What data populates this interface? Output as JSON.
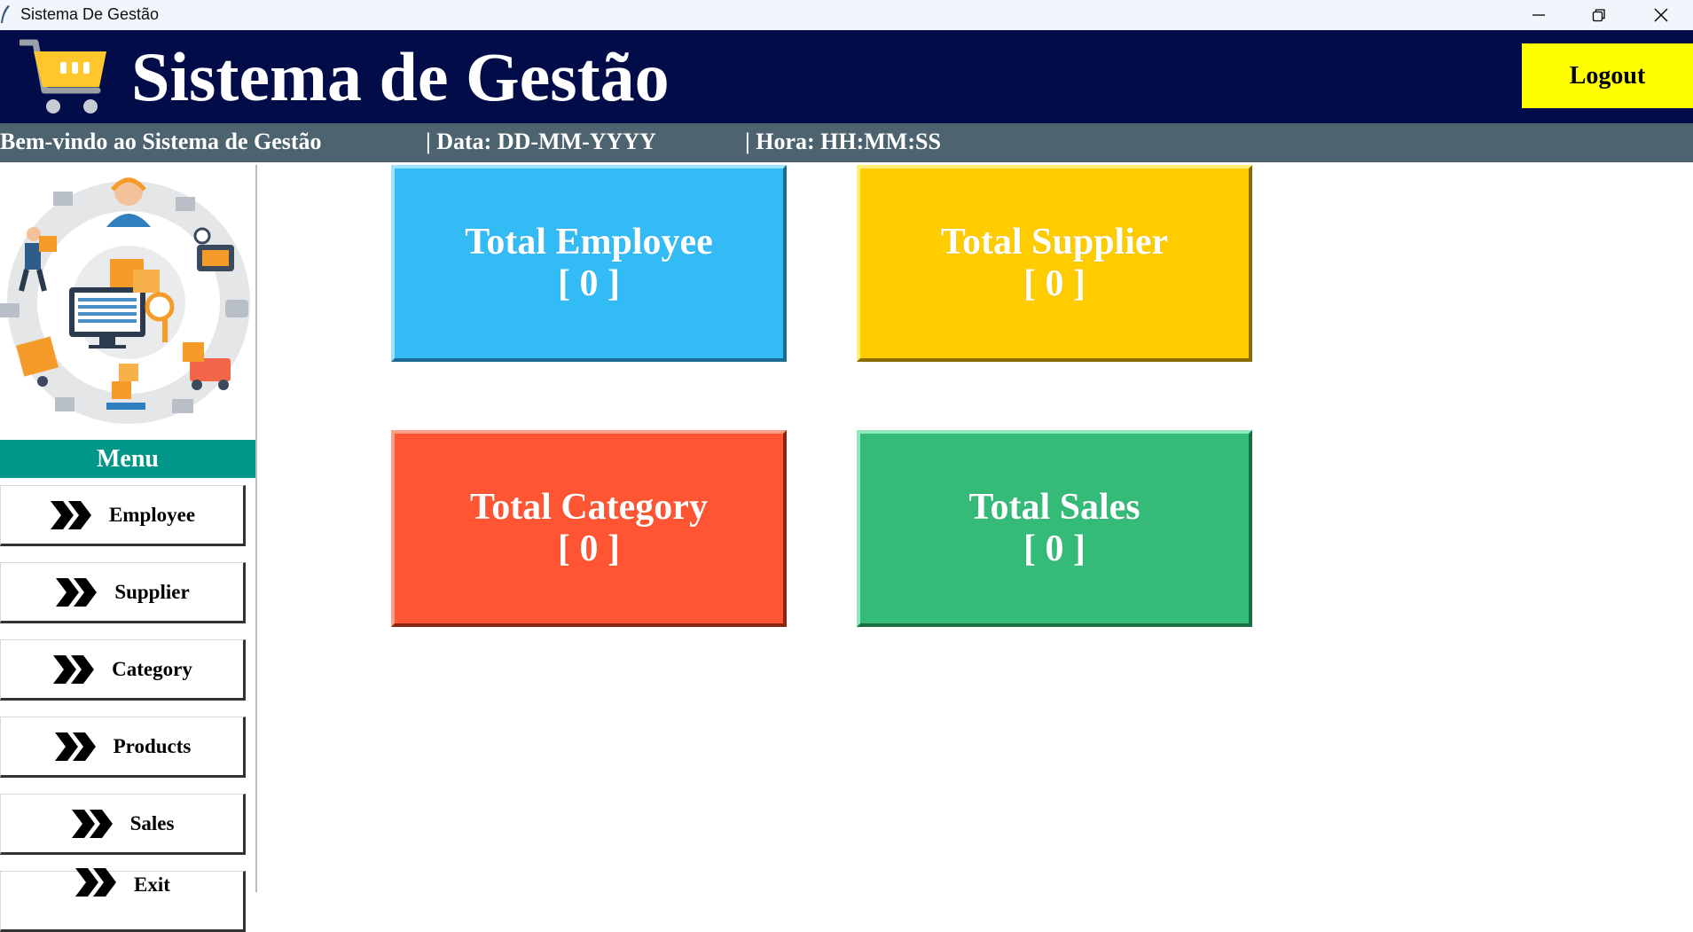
{
  "window": {
    "title": "Sistema De Gestão"
  },
  "header": {
    "app_title": "Sistema de Gestão",
    "logout_label": "Logout",
    "colors": {
      "background": "#010c48",
      "logout": "#ffff00",
      "cart": "#ffc72c"
    }
  },
  "subheader": {
    "welcome": "Bem-vindo ao Sistema de Gestão",
    "date": "| Data: DD-MM-YYYY",
    "time": "| Hora: HH:MM:SS"
  },
  "sidebar": {
    "menu_title": "Menu",
    "items": [
      {
        "label": "Employee"
      },
      {
        "label": "Supplier"
      },
      {
        "label": "Category"
      },
      {
        "label": "Products"
      },
      {
        "label": "Sales"
      },
      {
        "label": "Exit"
      }
    ]
  },
  "dashboard": {
    "cards": [
      {
        "title": "Total Employee",
        "value": "[ 0 ]",
        "color": "#33bbf6"
      },
      {
        "title": "Total Supplier",
        "value": "[ 0 ]",
        "color": "#ffcc00"
      },
      {
        "title": "Total Category",
        "value": "[ 0 ]",
        "color": "#ff5533"
      },
      {
        "title": "Total Sales",
        "value": "[ 0 ]",
        "color": "#35bb78"
      }
    ]
  }
}
